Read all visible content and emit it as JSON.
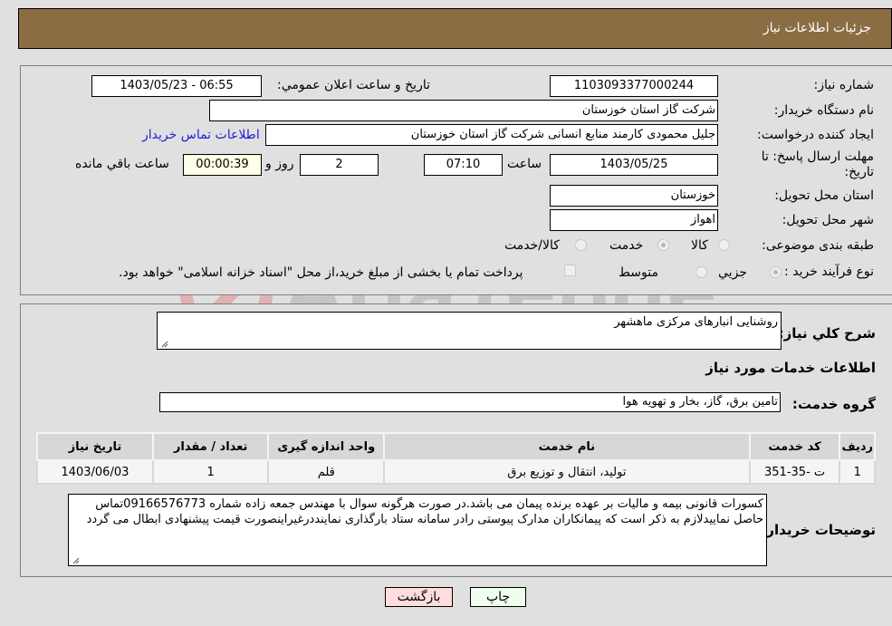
{
  "header": {
    "title": "جزئیات اطلاعات نیاز"
  },
  "details": {
    "need_number": {
      "label": "شماره نیاز:",
      "value": "1103093377000244"
    },
    "announce_datetime": {
      "label": "تاریخ و ساعت اعلان عمومي:",
      "value": "1403/05/23 - 06:55"
    },
    "buyer_org": {
      "label": "نام دستگاه خریدار:",
      "value": "شرکت گاز استان خوزستان"
    },
    "requester": {
      "label": "ایجاد کننده درخواست:",
      "value": "جلیل محمودی کارمند منابع انسانی شرکت گاز استان خوزستان"
    },
    "buyer_contact_link": "اطلاعات تماس خریدار",
    "deadline": {
      "label": "مهلت ارسال پاسخ: تا تاریخ:",
      "date": "1403/05/25",
      "time_label": "ساعت",
      "time": "07:10",
      "days": "2",
      "days_label": "روز و",
      "remaining": "00:00:39",
      "remaining_label": "ساعت باقي مانده"
    },
    "province": {
      "label": "استان محل تحویل:",
      "value": "خوزستان"
    },
    "city": {
      "label": "شهر محل تحویل:",
      "value": "اهواز"
    },
    "category": {
      "label": "طبقه بندی موضوعی:",
      "options": [
        "کالا",
        "خدمت",
        "کالا/خدمت"
      ],
      "selected": "خدمت"
    },
    "purchase_type": {
      "label": "نوع فرآیند خرید :",
      "options": [
        "جزیي",
        "متوسط"
      ],
      "selected": "جزیي",
      "treasury_note": "پرداخت تمام یا بخشی از مبلغ خرید،از محل \"اسناد خزانه اسلامی\" خواهد بود."
    }
  },
  "description": {
    "label": "شرح کلي نیاز:",
    "value": "روشنایی انبارهای مرکزی ماهشهر",
    "services_title": "اطلاعات خدمات مورد نیاز",
    "service_group_label": "گروه خدمت:",
    "service_group": "تامین برق، گاز، بخار و تهویه هوا"
  },
  "table": {
    "headers": [
      "ردیف",
      "کد خدمت",
      "نام خدمت",
      "واحد اندازه گیری",
      "تعداد / مقدار",
      "تاریخ نیاز"
    ],
    "rows": [
      [
        "1",
        "ت -35-351",
        "تولید، انتقال و توزیع برق",
        "قلم",
        "1",
        "1403/06/03"
      ]
    ]
  },
  "buyer_notes": {
    "label": "توضیحات خریدار:",
    "value": "کسورات قانونی بیمه و مالیات بر عهده برنده پیمان می باشد.در صورت هرگونه سوال با مهندس جمعه زاده شماره 09166576773تماس حاصل نماییدلازم به ذکر است که پیمانکاران مدارک پیوستی رادر سامانه ستاد بارگذاری نمایânددرغیراینصورت قیمت پیشنهادی ابطال می گردد"
  },
  "buttons": {
    "print": "چاپ",
    "back": "بازگشت"
  },
  "watermark": "AriaTender.neT",
  "colors": {
    "header_bg": "#8b6d43",
    "print_bg": "#eeffee",
    "back_bg": "#ffdddd",
    "link": "#1e1ed2"
  }
}
